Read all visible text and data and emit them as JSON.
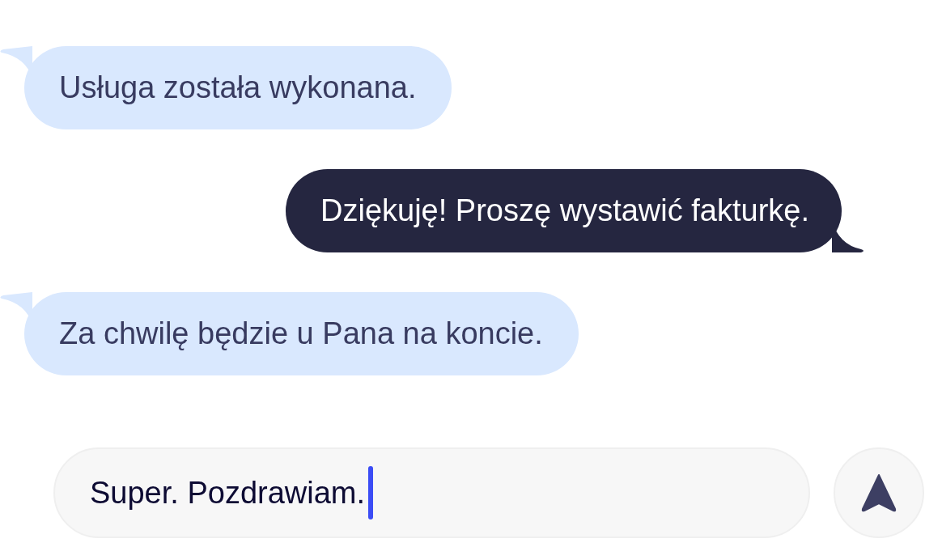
{
  "messages": [
    {
      "kind": "incoming",
      "text": "Usługa została wykonana."
    },
    {
      "kind": "outgoing",
      "text": "Dziękuję! Proszę wystawić fakturkę."
    },
    {
      "kind": "incoming",
      "text": "Za chwilę będzie u Pana na koncie."
    }
  ],
  "composer": {
    "value": "Super. Pozdrawiam.",
    "focused": true
  }
}
